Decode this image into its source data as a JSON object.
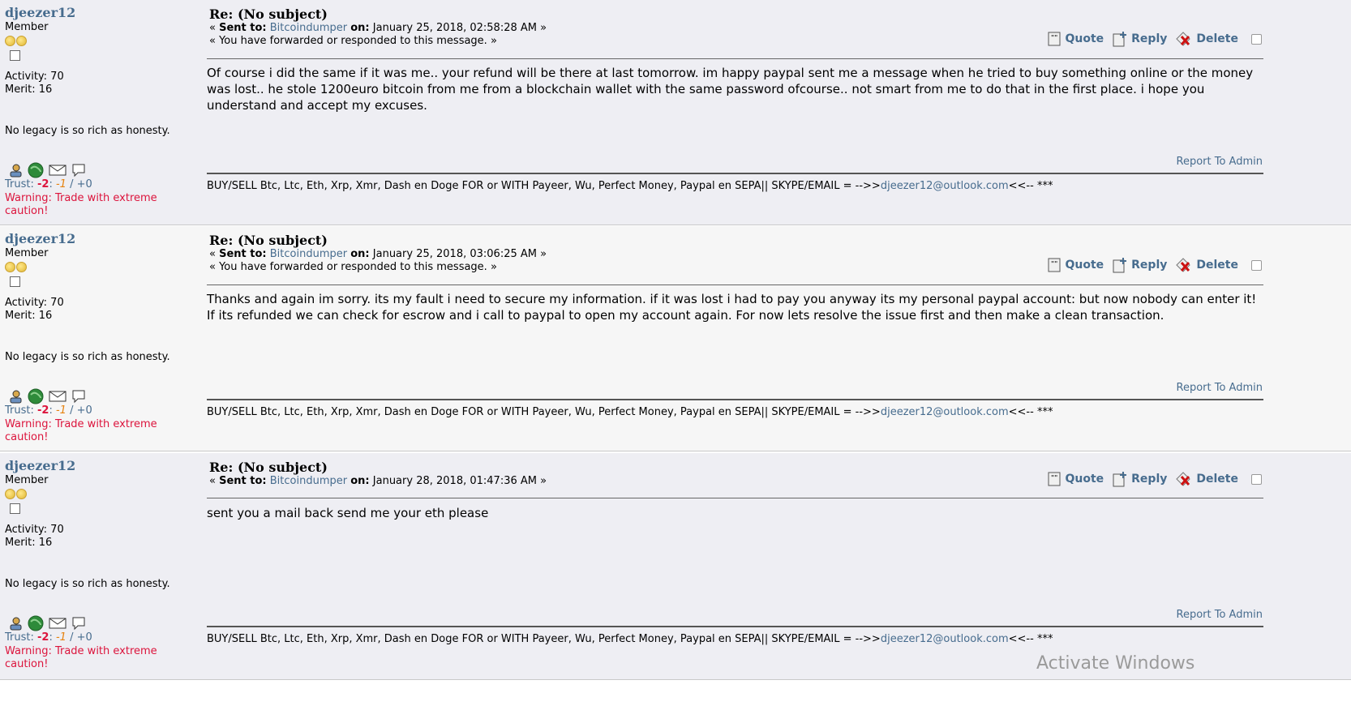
{
  "messages": [
    {
      "author": "djeezer12",
      "rank": "Member",
      "activity": "Activity: 70",
      "merit": "Merit: 16",
      "legacy": "No legacy is so rich as honesty.",
      "trust_label": "Trust: ",
      "trust_neg": "-2",
      "trust_sep": ": ",
      "trust_negsub": "-1",
      "trust_rest": " / +0",
      "warning": "Warning: Trade with extreme caution!",
      "subject": "Re: (No subject)",
      "sent_prefix": "« ",
      "sent_to_label": "Sent to:",
      "recipient": "Bitcoindumper",
      "on_label": "on:",
      "date": "January 25, 2018, 02:58:28 AM »",
      "forwarded": "« You have forwarded or responded to this message. »",
      "body": "Of course i did the same if it was me.. your refund will be there at last tomorrow. im happy paypal sent me a message when he tried to buy something online or the money was lost.. he stole 1200euro bitcoin from me from a blockchain wallet with the same password ofcourse.. not smart from me to do that in the first place. i hope you understand and accept my excuses.",
      "report": "Report To Admin",
      "sig_pre": "BUY/SELL Btc, Ltc, Eth, Xrp, Xmr, Dash en Doge FOR or WITH Payeer, Wu, Perfect Money, Paypal en SEPA|| SKYPE/EMAIL = -->>",
      "sig_link": "djeezer12@outlook.com",
      "sig_post": "<<-- ***"
    },
    {
      "author": "djeezer12",
      "rank": "Member",
      "activity": "Activity: 70",
      "merit": "Merit: 16",
      "legacy": "No legacy is so rich as honesty.",
      "trust_label": "Trust: ",
      "trust_neg": "-2",
      "trust_sep": ": ",
      "trust_negsub": "-1",
      "trust_rest": " / +0",
      "warning": "Warning: Trade with extreme caution!",
      "subject": "Re: (No subject)",
      "sent_prefix": "« ",
      "sent_to_label": "Sent to:",
      "recipient": "Bitcoindumper",
      "on_label": "on:",
      "date": "January 25, 2018, 03:06:25 AM »",
      "forwarded": "« You have forwarded or responded to this message. »",
      "body": "Thanks and again im sorry. its my fault i need to secure my information. if it was lost i had to pay you anyway its my personal paypal account: but now nobody can enter it! If its refunded we can check for escrow and i call to paypal to open my account again. For now lets resolve the issue first and then make a clean transaction.",
      "report": "Report To Admin",
      "sig_pre": "BUY/SELL Btc, Ltc, Eth, Xrp, Xmr, Dash en Doge FOR or WITH Payeer, Wu, Perfect Money, Paypal en SEPA|| SKYPE/EMAIL = -->>",
      "sig_link": "djeezer12@outlook.com",
      "sig_post": "<<-- ***"
    },
    {
      "author": "djeezer12",
      "rank": "Member",
      "activity": "Activity: 70",
      "merit": "Merit: 16",
      "legacy": "No legacy is so rich as honesty.",
      "trust_label": "Trust: ",
      "trust_neg": "-2",
      "trust_sep": ": ",
      "trust_negsub": "-1",
      "trust_rest": " / +0",
      "warning": "Warning: Trade with extreme caution!",
      "subject": "Re: (No subject)",
      "sent_prefix": "« ",
      "sent_to_label": "Sent to:",
      "recipient": "Bitcoindumper",
      "on_label": "on:",
      "date": "January 28, 2018, 01:47:36 AM »",
      "forwarded": "",
      "body": "sent you a mail back send me your eth please",
      "report": "Report To Admin",
      "sig_pre": "BUY/SELL Btc, Ltc, Eth, Xrp, Xmr, Dash en Doge FOR or WITH Payeer, Wu, Perfect Money, Paypal en SEPA|| SKYPE/EMAIL = -->>",
      "sig_link": "djeezer12@outlook.com",
      "sig_post": "<<-- ***"
    }
  ],
  "actions": {
    "quote": "Quote",
    "reply": "Reply",
    "delete": "Delete"
  },
  "icons": [
    "profile-icon",
    "website-icon",
    "email-icon",
    "pm-icon",
    "quote-icon",
    "reply-icon",
    "delete-icon"
  ],
  "colors": {
    "link": "#476c8e",
    "warning": "#dc143c",
    "row_a": "#eeeef3",
    "row_b": "#f6f6f6"
  },
  "watermark": "Activate Windows"
}
